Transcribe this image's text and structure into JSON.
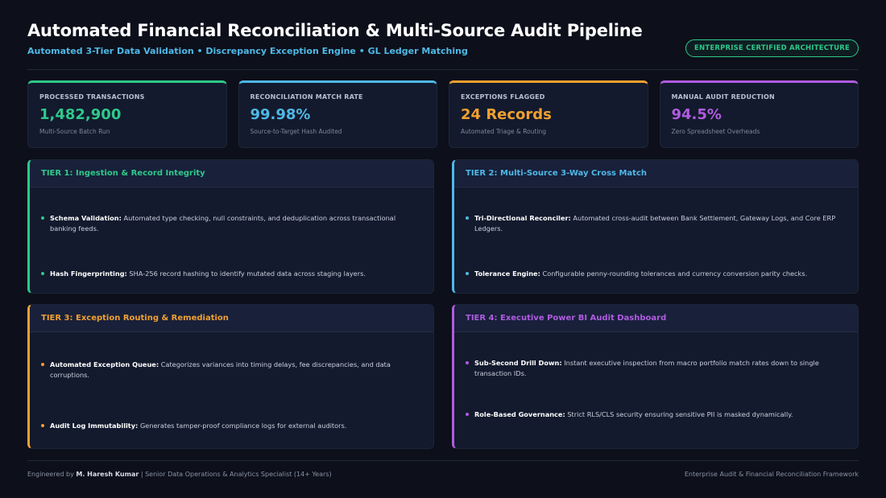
{
  "header": {
    "title": "Automated Financial Reconciliation & Multi-Source Audit Pipeline",
    "subtitle": "Automated 3-Tier Data Validation • Discrepancy Exception Engine • GL Ledger Matching",
    "badge": "ENTERPRISE CERTIFIED ARCHITECTURE"
  },
  "kpis": [
    {
      "label": "PROCESSED TRANSACTIONS",
      "value": "1,482,900",
      "note": "Multi-Source Batch Run",
      "color": "#2ec98a"
    },
    {
      "label": "RECONCILIATION MATCH RATE",
      "value": "99.98%",
      "note": "Source-to-Target Hash Audited",
      "color": "#4fb8e6"
    },
    {
      "label": "EXCEPTIONS FLAGGED",
      "value": "24 Records",
      "note": "Automated Triage & Routing",
      "color": "#f0a030"
    },
    {
      "label": "MANUAL AUDIT REDUCTION",
      "value": "94.5%",
      "note": "Zero Spreadsheet Overheads",
      "color": "#b05ce0"
    }
  ],
  "tiers": [
    {
      "title": "TIER 1: Ingestion & Record Integrity",
      "color": "#2ec98a",
      "items": [
        {
          "bold": "Schema Validation:",
          "text": " Automated type checking, null constraints, and deduplication across transactional banking feeds."
        },
        {
          "bold": "Hash Fingerprinting:",
          "text": " SHA-256 record hashing to identify mutated data across staging layers."
        }
      ]
    },
    {
      "title": "TIER 2: Multi-Source 3-Way Cross Match",
      "color": "#4fb8e6",
      "items": [
        {
          "bold": "Tri-Directional Reconciler:",
          "text": " Automated cross-audit between Bank Settlement, Gateway Logs, and Core ERP Ledgers."
        },
        {
          "bold": "Tolerance Engine:",
          "text": " Configurable penny-rounding tolerances and currency conversion parity checks."
        }
      ]
    },
    {
      "title": "TIER 3: Exception Routing & Remediation",
      "color": "#f0a030",
      "items": [
        {
          "bold": "Automated Exception Queue:",
          "text": " Categorizes variances into timing delays, fee discrepancies, and data corruptions."
        },
        {
          "bold": "Audit Log Immutability:",
          "text": " Generates tamper-proof compliance logs for external auditors."
        }
      ]
    },
    {
      "title": "TIER 4: Executive Power BI Audit Dashboard",
      "color": "#b05ce0",
      "items": [
        {
          "bold": "Sub-Second Drill Down:",
          "text": " Instant executive inspection from macro portfolio match rates down to single transaction IDs."
        },
        {
          "bold": "Role-Based Governance:",
          "text": " Strict RLS/CLS security ensuring sensitive PII is masked dynamically."
        }
      ]
    }
  ],
  "footer": {
    "prefix": "Engineered by ",
    "author": "M. Haresh Kumar",
    "suffix": " | Senior Data Operations & Analytics Specialist (14+ Years)",
    "right": "Enterprise Audit & Financial Reconciliation Framework"
  }
}
